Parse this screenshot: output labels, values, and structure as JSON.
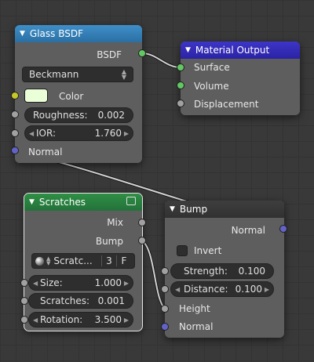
{
  "nodes": {
    "glass": {
      "title": "Glass BSDF",
      "output_bsdf": "BSDF",
      "distribution": "Beckmann",
      "color_label": "Color",
      "color_value": "#eaffd8",
      "roughness": {
        "label": "Roughness:",
        "value": "0.002"
      },
      "ior": {
        "label": "IOR:",
        "value": "1.760"
      },
      "normal_label": "Normal"
    },
    "output": {
      "title": "Material Output",
      "surface": "Surface",
      "volume": "Volume",
      "displacement": "Displacement"
    },
    "scratches": {
      "title": "Scratches",
      "out_mix": "Mix",
      "out_bump": "Bump",
      "datablock": {
        "name": "Scratc...",
        "users": "3",
        "fake": "F"
      },
      "size": {
        "label": "Size:",
        "value": "1.000"
      },
      "scratches": {
        "label": "Scratches:",
        "value": "0.001"
      },
      "rotation": {
        "label": "Rotation:",
        "value": "3.500"
      }
    },
    "bump": {
      "title": "Bump",
      "out_normal": "Normal",
      "invert_label": "Invert",
      "invert_checked": false,
      "strength": {
        "label": "Strength:",
        "value": "0.100"
      },
      "distance": {
        "label": "Distance:",
        "value": "0.100"
      },
      "height_label": "Height",
      "normal_label": "Normal"
    }
  },
  "colors": {
    "glass_header": "#2a6fa3",
    "output_header": "#2b23a4",
    "scratches_header": "#23723a",
    "bump_header": "#313131",
    "socket_shader": "#63c763",
    "socket_float": "#a1a1a1",
    "socket_vector": "#6363c7",
    "socket_color": "#c7c729"
  }
}
